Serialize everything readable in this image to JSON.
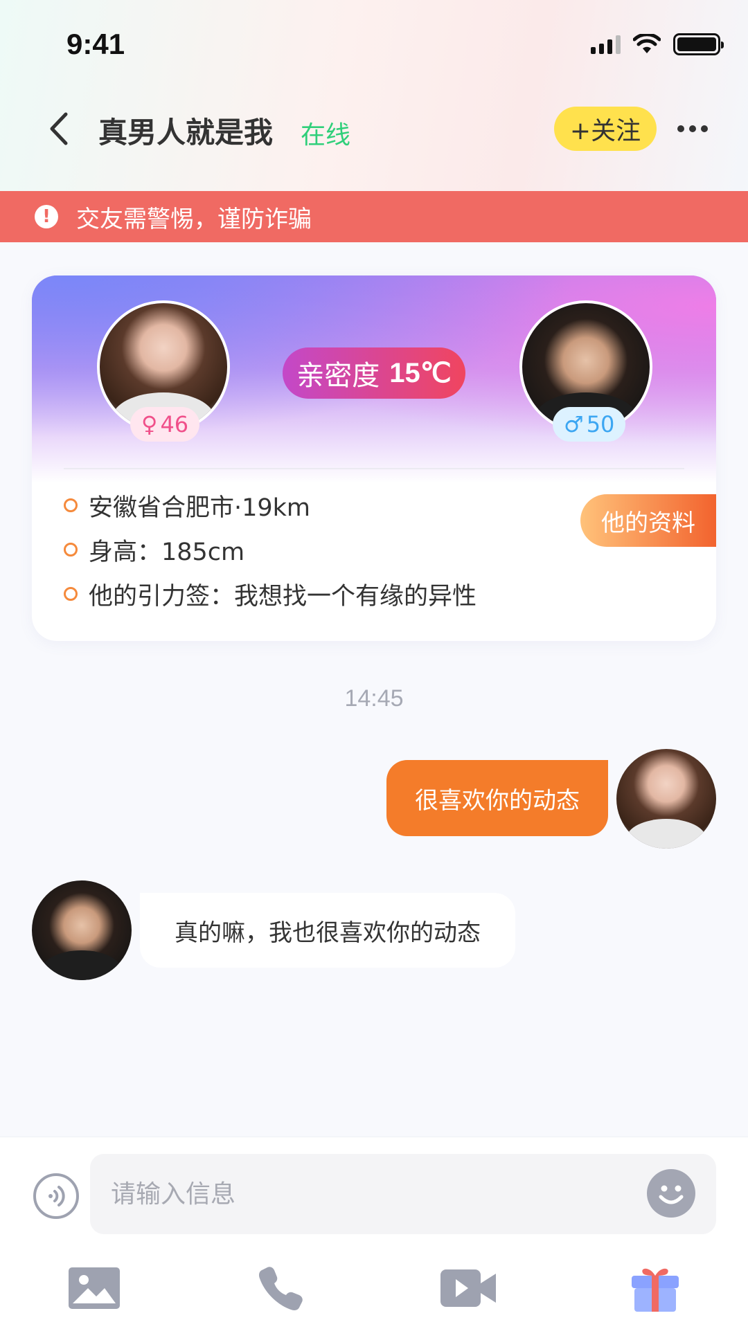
{
  "status_bar": {
    "time": "9:41"
  },
  "header": {
    "title": "真男人就是我",
    "status": "在线",
    "follow_label": "+关注"
  },
  "warning": {
    "text": "交友需警惕，谨防诈骗"
  },
  "profile_card": {
    "left_user": {
      "gender_symbol": "♀",
      "age": "46"
    },
    "right_user": {
      "gender_symbol": "♂",
      "age": "50"
    },
    "intimacy_label": "亲密度",
    "intimacy_value": "15℃",
    "info_items": [
      {
        "text": "安徽省合肥市·19km"
      },
      {
        "text": "身高：185cm"
      },
      {
        "text": "他的引力签：我想找一个有缘的异性"
      }
    ],
    "profile_button": "他的资料"
  },
  "chat": {
    "timestamp": "14:45",
    "messages": [
      {
        "side": "right",
        "text": "很喜欢你的动态"
      },
      {
        "side": "left",
        "text": "真的嘛，我也很喜欢你的动态"
      }
    ]
  },
  "input": {
    "placeholder": "请输入信息",
    "value": ""
  },
  "toolbar": {
    "icons": [
      "image-icon",
      "phone-icon",
      "video-icon",
      "gift-icon"
    ]
  },
  "colors": {
    "accent_orange": "#f47c2a",
    "warning_red": "#f06a63",
    "follow_yellow": "#ffe14d",
    "online_green": "#2fcf7a"
  }
}
